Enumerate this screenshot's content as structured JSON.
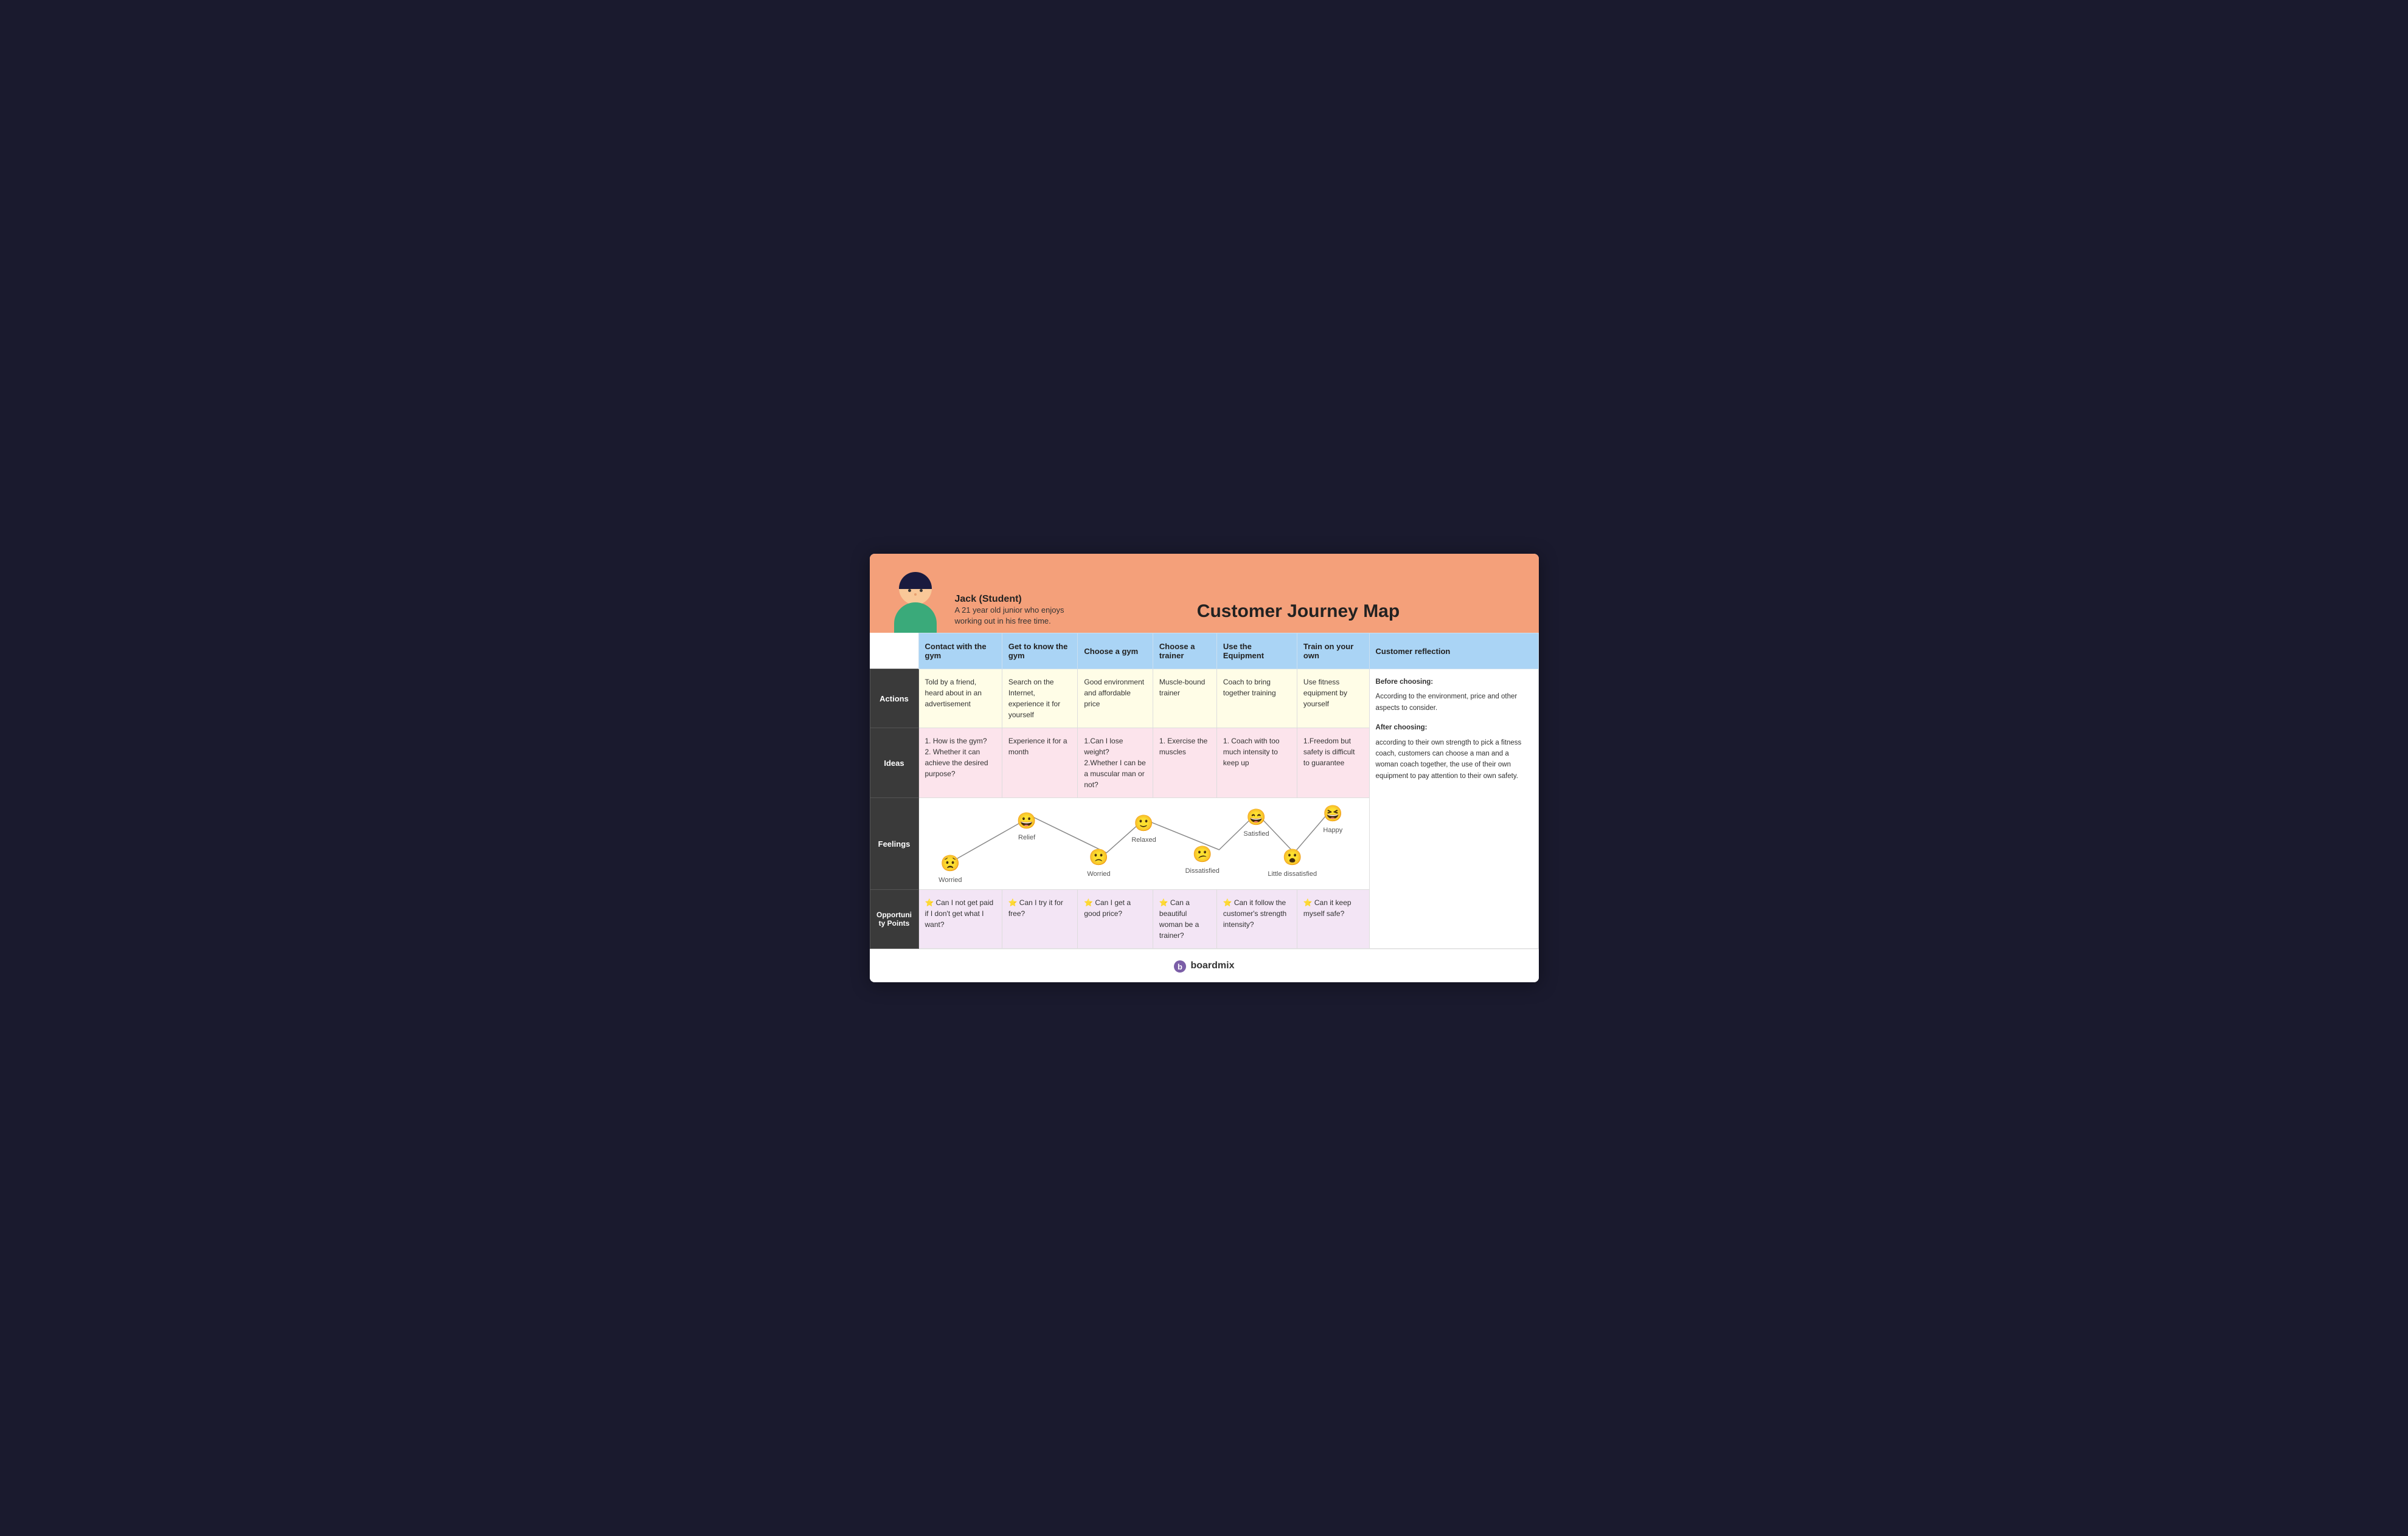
{
  "header": {
    "persona_name": "Jack (Student)",
    "persona_desc": "A 21 year old junior who enjoys working out in his free time.",
    "title": "Customer Journey Map"
  },
  "columns": [
    "Contact with the gym",
    "Get to know the gym",
    "Choose a gym",
    "Choose a trainer",
    "Use the Equipment",
    "Train on your own",
    "Customer reflection"
  ],
  "rows": {
    "actions": {
      "label": "Actions",
      "cells": [
        "Told by a friend, heard about in an advertisement",
        "Search on the Internet, experience it for yourself",
        "Good environment and affordable price",
        "Muscle-bound trainer",
        "Coach to bring together training",
        "Use fitness equipment by yourself"
      ],
      "reflection": ""
    },
    "ideas": {
      "label": "Ideas",
      "cells": [
        "1. How is the gym?\n2. Whether it can achieve the desired purpose?",
        "Experience it for a month",
        "1.Can I lose weight?\n2.Whether I can be a muscular man or not?",
        "1. Exercise the muscles",
        "1. Coach with too much intensity to keep up",
        "1.Freedom but safety is difficult to guarantee"
      ],
      "reflection": "Before choosing:\nAccording to the environment, price and other aspects to consider.\n\nAfter choosing:\naccording to their own strength to pick a fitness coach, customers can choose a man and a woman coach together, the use of their own equipment to pay attention to their own safety."
    },
    "feelings": {
      "label": "Feelings",
      "points": [
        {
          "label": "Worried",
          "emoji": "😟",
          "level": 0.85
        },
        {
          "label": "Relief",
          "emoji": "😀",
          "level": 0.25
        },
        {
          "label": "Worried",
          "emoji": "🙁",
          "level": 0.75
        },
        {
          "label": "Relaxed",
          "emoji": "🙂",
          "level": 0.3
        },
        {
          "label": "Dissatisfied",
          "emoji": "😕",
          "level": 0.7
        },
        {
          "label": "Satisfied",
          "emoji": "😄",
          "level": 0.2
        },
        {
          "label": "Little dissatisfied",
          "emoji": "😮",
          "level": 0.75
        },
        {
          "label": "Happy",
          "emoji": "😆",
          "level": 0.15
        }
      ]
    },
    "opportunities": {
      "label": "Opportunity Points",
      "cells": [
        "⭐Can I not get paid if I don't get what I want?",
        "⭐Can I try it for free?",
        "⭐Can I get a good price?",
        "⭐Can a beautiful woman be a trainer?",
        "⭐Can it follow the customer's strength intensity?",
        "⭐Can it keep myself safe?"
      ],
      "reflection": ""
    }
  },
  "footer": {
    "brand": "boardmix"
  }
}
